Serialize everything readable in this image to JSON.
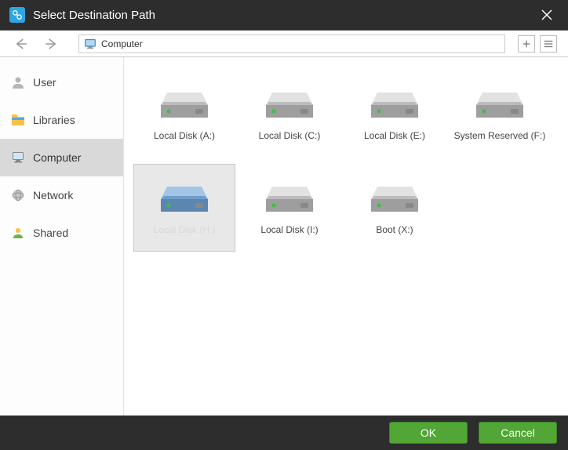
{
  "window": {
    "title": "Select Destination Path"
  },
  "toolbar": {
    "breadcrumb": "Computer"
  },
  "sidebar": {
    "items": [
      {
        "label": "User",
        "selected": false
      },
      {
        "label": "Libraries",
        "selected": false
      },
      {
        "label": "Computer",
        "selected": true
      },
      {
        "label": "Network",
        "selected": false
      },
      {
        "label": "Shared",
        "selected": false
      }
    ]
  },
  "drives": [
    {
      "label": "Local Disk (A:)",
      "selected": false
    },
    {
      "label": "Local Disk (C:)",
      "selected": false
    },
    {
      "label": "Local Disk (E:)",
      "selected": false
    },
    {
      "label": "System Reserved (F:)",
      "selected": false
    },
    {
      "label": "Local Disk (H:)",
      "selected": true
    },
    {
      "label": "Local Disk (I:)",
      "selected": false
    },
    {
      "label": "Boot (X:)",
      "selected": false
    }
  ],
  "footer": {
    "ok": "OK",
    "cancel": "Cancel"
  }
}
